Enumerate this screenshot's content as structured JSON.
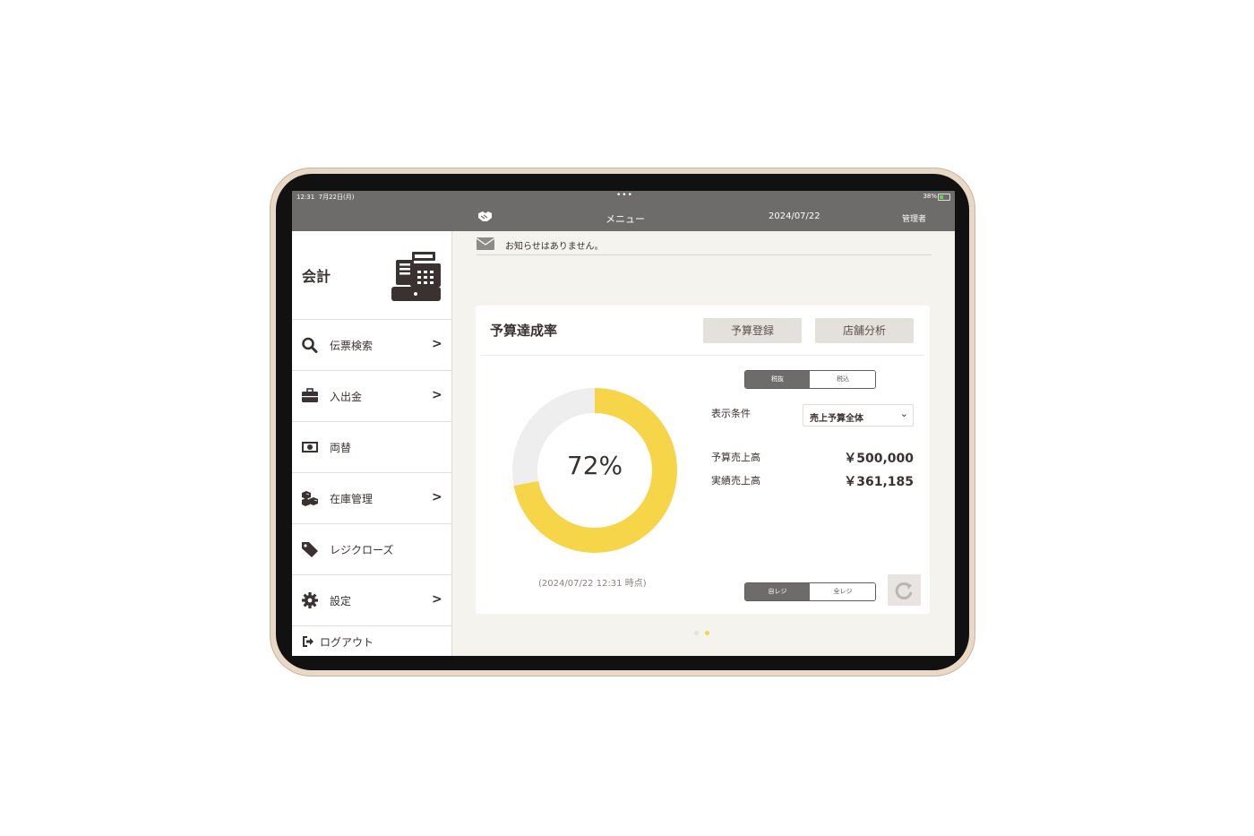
{
  "status_bar": {
    "time": "12:31",
    "date": "7月22日(月)",
    "dots": "•••",
    "battery_pct": "38%"
  },
  "navbar": {
    "logo_icon": "handshake-logo-icon",
    "title": "メニュー",
    "date": "2024/07/22",
    "user": "管理者"
  },
  "sidebar": {
    "header": {
      "label": "会計",
      "icon": "cash-register-icon"
    },
    "items": [
      {
        "label": "伝票検索",
        "icon": "search-icon",
        "has_chevron": true
      },
      {
        "label": "入出金",
        "icon": "briefcase-icon",
        "has_chevron": true
      },
      {
        "label": "両替",
        "icon": "money-bill-icon",
        "has_chevron": false
      },
      {
        "label": "在庫管理",
        "icon": "cubes-icon",
        "has_chevron": true
      },
      {
        "label": "レジクローズ",
        "icon": "tag-icon",
        "has_chevron": false
      },
      {
        "label": "設定",
        "icon": "gear-icon",
        "has_chevron": true
      }
    ],
    "logout_label": "ログアウト",
    "chevron": ">"
  },
  "notice": {
    "icon": "envelope-icon",
    "text": "お知らせはありません。"
  },
  "budget_card": {
    "title": "予算達成率",
    "buttons": {
      "register": "予算登録",
      "analysis": "店舗分析"
    },
    "tax_toggle": {
      "selected": "税抜",
      "other": "税込"
    },
    "condition_label": "表示条件",
    "condition_value": "売上予算全体",
    "condition_arrow": "⌄",
    "budget_label": "予算売上高",
    "budget_value": "￥500,000",
    "actual_label": "実績売上高",
    "actual_value": "￥361,185",
    "achievement_pct": 72,
    "achievement_text": "72%",
    "timestamp": "(2024/07/22 12:31 時点)",
    "register_toggle": {
      "selected": "自レジ",
      "other": "全レジ"
    },
    "refresh_icon": "refresh-icon"
  },
  "pager": {
    "pages": 2,
    "active": 1
  },
  "colors": {
    "accent": "#f7d548",
    "donut_track": "#eeeeee",
    "navbar": "#6e6c6a",
    "background": "#f5f3ee"
  }
}
